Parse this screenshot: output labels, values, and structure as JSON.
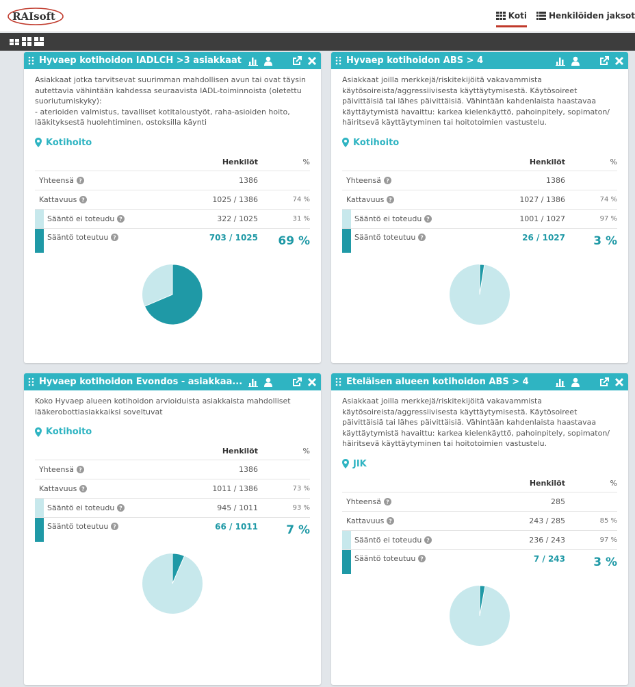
{
  "header": {
    "logo_text": "RAIsoft",
    "nav": [
      {
        "label": "Koti",
        "active": true
      },
      {
        "label": "Henkilöiden jaksot",
        "active": false
      }
    ]
  },
  "colors": {
    "accent": "#2fb4c2",
    "dark": "#1f99a6",
    "light": "#c7e8ec",
    "active_nav": "#c0392b"
  },
  "labels": {
    "persons": "Henkilöt",
    "percent": "%",
    "total": "Yhteensä",
    "coverage": "Kattavuus",
    "rule_not_met": "Sääntö ei toteudu",
    "rule_met": "Sääntö toteutuu"
  },
  "cards": [
    {
      "title": "Hyvaep kotihoidon IADLCH >3 asiakkaat",
      "description": "Asiakkaat jotka tarvitsevat suurimman mahdollisen avun tai ovat täysin autettavia vähintään kahdessa seuraavista IADL-toiminnoista (oletettu suoriutumiskyky):\n- aterioiden valmistus, tavalliset kotitaloustyöt, raha-asioiden hoito, lääkityksestä huolehtiminen, ostoksilla käynti",
      "location": "Kotihoito",
      "total": "1386",
      "coverage": "1025 / 1386",
      "coverage_pct": "74 %",
      "not_met": "322 / 1025",
      "not_met_pct": "31 %",
      "met": "703 / 1025",
      "met_pct": "69 %",
      "met_fraction": 0.686
    },
    {
      "title": "Hyvaep kotihoidon ABS > 4",
      "description": "Asiakkaat joilla merkkejä/riskitekijöitä vakavammista käytösoireista/aggressiivisesta käyttäytymisestä. Käytösoireet päivittäisiä tai lähes päivittäisiä. Vähintään kahdenlaista haastavaa käyttäytymistä havaittu: karkea kielenkäyttö, pahoinpitely, sopimaton/ häiritsevä käyttäytyminen tai hoitotoimien vastustelu.",
      "location": "Kotihoito",
      "total": "1386",
      "coverage": "1027 / 1386",
      "coverage_pct": "74 %",
      "not_met": "1001 / 1027",
      "not_met_pct": "97 %",
      "met": "26 / 1027",
      "met_pct": "3 %",
      "met_fraction": 0.025
    },
    {
      "title": "Hyvaep kotihoidon Evondos - asiakkaa...",
      "description": "Koko Hyvaep alueen kotihoidon arvioiduista asiakkaista mahdolliset lääkerobottiasiakkaiksi soveltuvat",
      "location": "Kotihoito",
      "total": "1386",
      "coverage": "1011 / 1386",
      "coverage_pct": "73 %",
      "not_met": "945 / 1011",
      "not_met_pct": "93 %",
      "met": "66 / 1011",
      "met_pct": "7 %",
      "met_fraction": 0.065
    },
    {
      "title": "Eteläisen alueen kotihoidon ABS > 4",
      "description": "Asiakkaat joilla merkkejä/riskitekijöitä vakavammista käytösoireista/aggressiivisesta käyttäytymisestä. Käytösoireet päivittäisiä tai lähes päivittäisiä. Vähintään kahdenlaista haastavaa käyttäytymistä havaittu: karkea kielenkäyttö, pahoinpitely, sopimaton/ häiritsevä käyttäytyminen tai hoitotoimien vastustelu.",
      "location": "JIK",
      "total": "285",
      "coverage": "243 / 285",
      "coverage_pct": "85 %",
      "not_met": "236 / 243",
      "not_met_pct": "97 %",
      "met": "7 / 243",
      "met_pct": "3 %",
      "met_fraction": 0.029
    }
  ]
}
